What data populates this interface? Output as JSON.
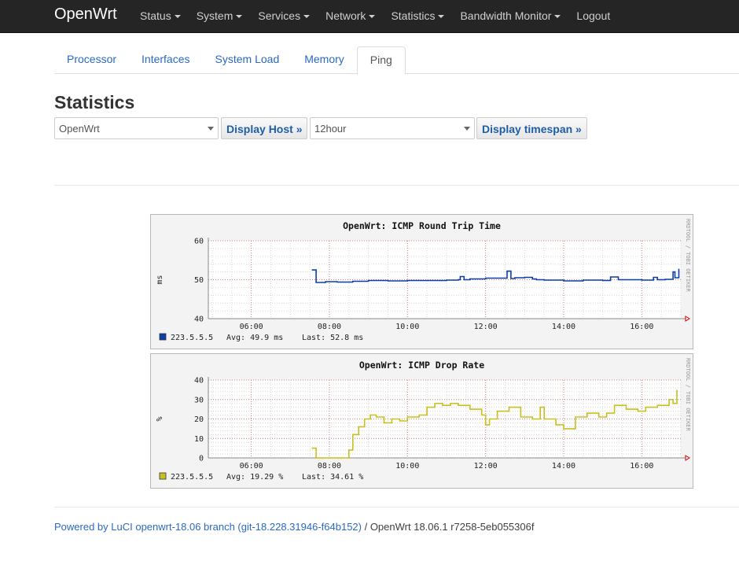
{
  "navbar": {
    "brand": "OpenWrt",
    "menus": [
      {
        "label": "Status",
        "dropdown": true
      },
      {
        "label": "System",
        "dropdown": true
      },
      {
        "label": "Services",
        "dropdown": true
      },
      {
        "label": "Network",
        "dropdown": true
      },
      {
        "label": "Statistics",
        "dropdown": true
      },
      {
        "label": "Bandwidth Monitor",
        "dropdown": true
      },
      {
        "label": "Logout",
        "dropdown": false
      }
    ]
  },
  "tabs": [
    {
      "label": "Processor",
      "active": false
    },
    {
      "label": "Interfaces",
      "active": false
    },
    {
      "label": "System Load",
      "active": false
    },
    {
      "label": "Memory",
      "active": false
    },
    {
      "label": "Ping",
      "active": true
    }
  ],
  "page": {
    "title": "Statistics",
    "host_select": {
      "value": "OpenWrt"
    },
    "host_button": "Display Host »",
    "timespan_select": {
      "value": "12hour"
    },
    "timespan_button": "Display timespan »"
  },
  "chart_data": [
    {
      "type": "line",
      "title": "OpenWrt: ICMP Round Trip Time",
      "ylabel": "ms",
      "ylim": [
        40,
        60
      ],
      "yticks": [
        "40",
        "50",
        "60"
      ],
      "xticks": [
        "06:00",
        "08:00",
        "10:00",
        "12:00",
        "14:00",
        "16:00"
      ],
      "xlim": [
        4.9,
        17.0
      ],
      "side_label": "RRDTOOL / TOBI OETIKER",
      "color": "#0b3fa8",
      "series": [
        {
          "name": "223.5.5.5",
          "x": [
            7.55,
            7.65,
            7.66,
            7.9,
            8.2,
            8.6,
            9.0,
            9.5,
            10.0,
            10.5,
            11.0,
            11.3,
            11.35,
            11.45,
            11.6,
            12.0,
            12.5,
            12.55,
            12.65,
            12.75,
            13.0,
            13.2,
            13.3,
            13.5,
            14.0,
            14.5,
            15.0,
            15.2,
            15.4,
            15.8,
            16.0,
            16.3,
            16.4,
            16.6,
            16.8,
            16.85,
            16.95
          ],
          "y": [
            52.5,
            52.5,
            49.3,
            49.5,
            49.4,
            49.6,
            49.8,
            49.7,
            49.8,
            49.8,
            49.9,
            50.0,
            50.8,
            50.0,
            50.2,
            50.4,
            50.4,
            52.2,
            50.3,
            50.5,
            50.6,
            50.2,
            50.0,
            49.9,
            49.7,
            49.9,
            49.8,
            50.7,
            50.0,
            50.0,
            49.9,
            50.6,
            50.0,
            50.1,
            52.0,
            50.5,
            52.8
          ]
        }
      ],
      "legend": {
        "label": "223.5.5.5",
        "avg": "Avg:   49.9 ms",
        "last": "Last:   52.8 ms"
      }
    },
    {
      "type": "line",
      "title": "OpenWrt: ICMP Drop Rate",
      "ylabel": "%",
      "ylim": [
        0,
        40
      ],
      "yticks": [
        "0",
        "10",
        "20",
        "30",
        "40"
      ],
      "xticks": [
        "06:00",
        "08:00",
        "10:00",
        "12:00",
        "14:00",
        "16:00"
      ],
      "xlim": [
        4.9,
        17.0
      ],
      "side_label": "RRDTOOL / TOBI OETIKER",
      "color": "#c7c020",
      "series": [
        {
          "name": "223.5.5.5",
          "x": [
            7.55,
            7.62,
            7.66,
            8.3,
            8.5,
            8.6,
            8.75,
            8.9,
            9.05,
            9.2,
            9.4,
            9.6,
            9.8,
            10.0,
            10.3,
            10.5,
            10.7,
            10.9,
            11.1,
            11.3,
            11.6,
            11.9,
            12.0,
            12.1,
            12.3,
            12.6,
            12.9,
            13.2,
            13.4,
            13.5,
            13.8,
            14.0,
            14.3,
            14.6,
            14.9,
            15.1,
            15.3,
            15.6,
            15.9,
            16.1,
            16.4,
            16.7,
            16.8,
            16.9
          ],
          "y": [
            5,
            5,
            0,
            0,
            4,
            12,
            16,
            20,
            22,
            21,
            18,
            20,
            19,
            21,
            22,
            26,
            28,
            27,
            28,
            27,
            25,
            22,
            17,
            20,
            24,
            26,
            21,
            20,
            26,
            20,
            17,
            15,
            21,
            23,
            21,
            23,
            27,
            25,
            24,
            26,
            27,
            30,
            28,
            35
          ]
        }
      ],
      "legend": {
        "label": "223.5.5.5",
        "avg": "Avg:  19.29 %",
        "last": "Last:  34.61 %"
      }
    }
  ],
  "footer": {
    "link_text": "Powered by LuCI openwrt-18.06 branch (git-18.228.31946-f64b152)",
    "rest": " / OpenWrt 18.06.1 r7258-5eb055306f"
  }
}
